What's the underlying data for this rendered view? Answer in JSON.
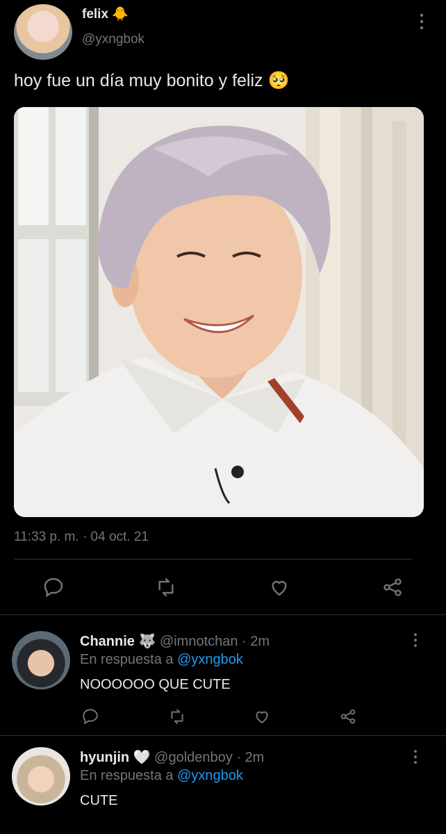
{
  "tweet": {
    "author": {
      "name": "felix",
      "emoji": "🐥",
      "handle": "@yxngbok",
      "avatar": "felix-avatar-photo"
    },
    "text": "hoy fue un día muy bonito y feliz",
    "text_emoji": "🥺",
    "photo": "portrait-photo-smiling-person-lavender-hair-white-shirt",
    "time": "11:33 p. m.",
    "date": "04 oct. 21",
    "separator": "·",
    "actions": [
      "reply-icon",
      "retweet-icon",
      "like-icon",
      "share-icon"
    ]
  },
  "replies": [
    {
      "name": "Channie",
      "emoji": "🐺",
      "handle": "@imnotchan",
      "time": "2m",
      "replying_label": "En respuesta a",
      "replying_to": "@yxngbok",
      "text": "NOOOOOO QUE CUTE"
    },
    {
      "name": "hyunjin",
      "emoji": "🤍",
      "handle": "@goldenboy",
      "time": "2m",
      "replying_label": "En respuesta a",
      "replying_to": "@yxngbok",
      "text": "CUTE"
    }
  ],
  "colors": {
    "background": "#000000",
    "text": "#e7e9ea",
    "muted": "#71767b",
    "link": "#1d9bf0",
    "divider": "#2f3336"
  }
}
